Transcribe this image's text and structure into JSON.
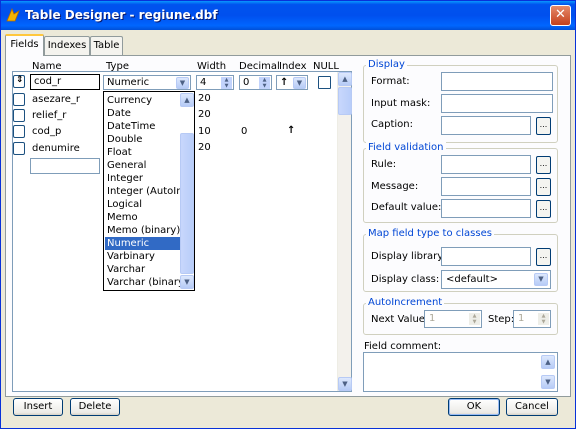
{
  "window": {
    "title": "Table Designer - regiune.dbf",
    "close_glyph": "✕"
  },
  "tabs": [
    {
      "label": "Fields"
    },
    {
      "label": "Indexes"
    },
    {
      "label": "Table"
    }
  ],
  "columns": {
    "name": "Name",
    "type": "Type",
    "width": "Width",
    "decimal": "Decimal",
    "index": "Index",
    "null": "NULL"
  },
  "current_row": {
    "name": "cod_r",
    "type": "Numeric",
    "width": "4",
    "decimal": "0",
    "index_glyph": "↑",
    "null_checked": false
  },
  "rows": [
    {
      "name": "asezare_r",
      "width": "20",
      "decimal": "",
      "index": ""
    },
    {
      "name": "relief_r",
      "width": "20",
      "decimal": "",
      "index": ""
    },
    {
      "name": "cod_p",
      "width": "10",
      "decimal": "0",
      "index": "↑"
    },
    {
      "name": "denumire",
      "width": "20",
      "decimal": "",
      "index": ""
    }
  ],
  "new_row": {
    "name": ""
  },
  "type_options": [
    "Currency",
    "Date",
    "DateTime",
    "Double",
    "Float",
    "General",
    "Integer",
    "Integer (AutoInc)",
    "Logical",
    "Memo",
    "Memo (binary)",
    "Numeric",
    "Varbinary",
    "Varchar",
    "Varchar (binary)"
  ],
  "type_selected": "Numeric",
  "display": {
    "title": "Display",
    "format_label": "Format:",
    "format_value": "",
    "input_mask_label": "Input mask:",
    "input_mask_value": "",
    "caption_label": "Caption:",
    "caption_value": ""
  },
  "field_validation": {
    "title": "Field validation",
    "rule_label": "Rule:",
    "rule_value": "",
    "message_label": "Message:",
    "message_value": "",
    "default_label": "Default value:",
    "default_value": ""
  },
  "map_field": {
    "title": "Map field type to classes",
    "display_library_label": "Display library:",
    "display_library_value": "",
    "display_class_label": "Display class:",
    "display_class_value": "<default>"
  },
  "autoincrement": {
    "title": "AutoIncrement",
    "next_value_label": "Next Value:",
    "next_value": "1",
    "step_label": "Step:",
    "step_value": "1"
  },
  "field_comment": {
    "label": "Field comment:",
    "value": ""
  },
  "buttons": {
    "insert": "Insert",
    "delete": "Delete",
    "ok": "OK",
    "cancel": "Cancel",
    "ellipsis": "..."
  },
  "colors": {
    "titlebar": "#0053ee",
    "selection": "#316ac5",
    "group_title": "#0046d5",
    "window_bg": "#ece9d8"
  }
}
